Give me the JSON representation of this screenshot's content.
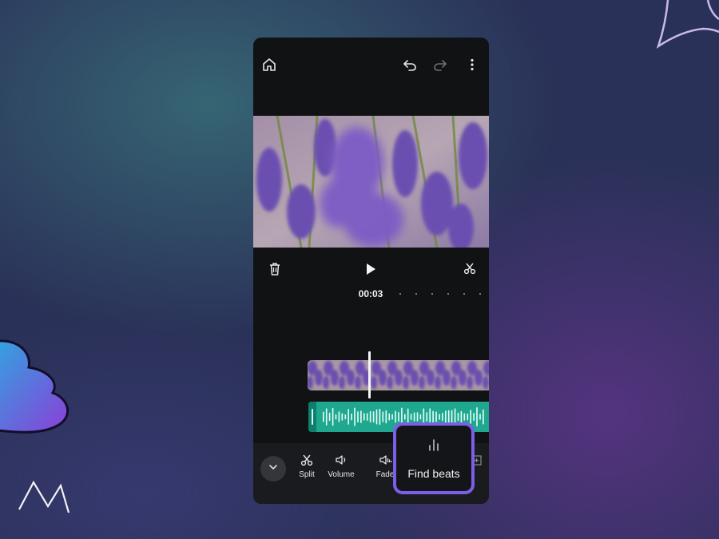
{
  "screen": "video editor",
  "player": {
    "timecode": "00:03"
  },
  "toolbar": {
    "tools": [
      {
        "label": "Split",
        "icon": "scissors-icon"
      },
      {
        "label": "Volume",
        "icon": "volume-icon"
      },
      {
        "label": "Fade",
        "icon": "fade-icon"
      }
    ],
    "highlight": {
      "label": "Find beats",
      "icon": "beats-icon"
    }
  },
  "icons": {
    "topbar": [
      "home-icon",
      "undo-icon",
      "redo-icon",
      "more-vertical-icon"
    ],
    "player": [
      "trash-icon",
      "play-icon",
      "scissors-icon"
    ],
    "collapse": "chevron-down-icon"
  },
  "colors": {
    "phone_background": "#111214",
    "audio_track": "#1fa88f",
    "highlight_border": "#7c5fe6",
    "background_teal": "#386e78",
    "background_purple": "#62348c"
  }
}
